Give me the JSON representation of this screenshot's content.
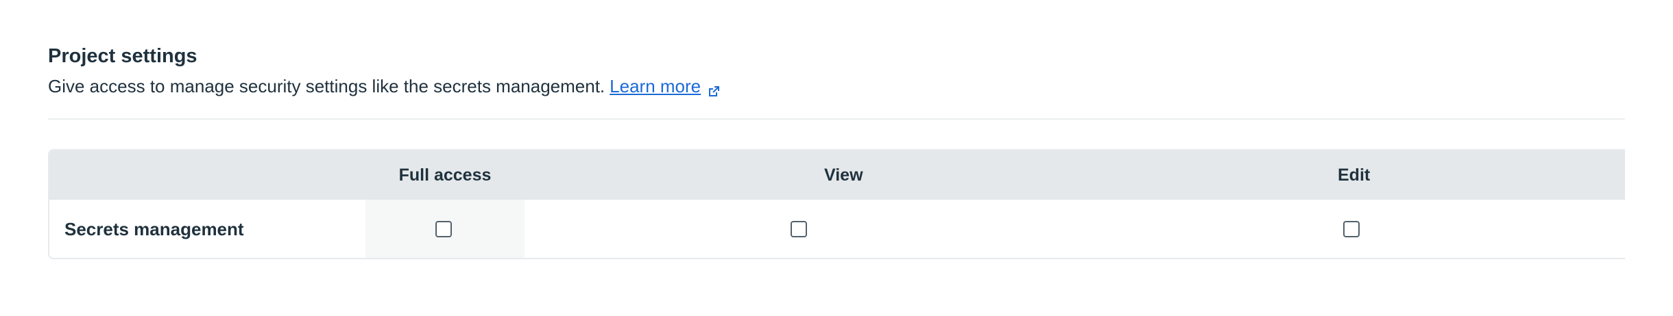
{
  "section": {
    "title": "Project settings",
    "description": "Give access to manage security settings like the secrets management.",
    "learn_more": "Learn more",
    "link_icon": "external-link-icon",
    "link_color": "#1a6ad6"
  },
  "table": {
    "columns": [
      "",
      "Full access",
      "View",
      "Edit"
    ],
    "rows": [
      {
        "label": "Secrets management",
        "full_access": false,
        "view": false,
        "edit": false
      }
    ],
    "header_bg": "#e4e8ea"
  }
}
